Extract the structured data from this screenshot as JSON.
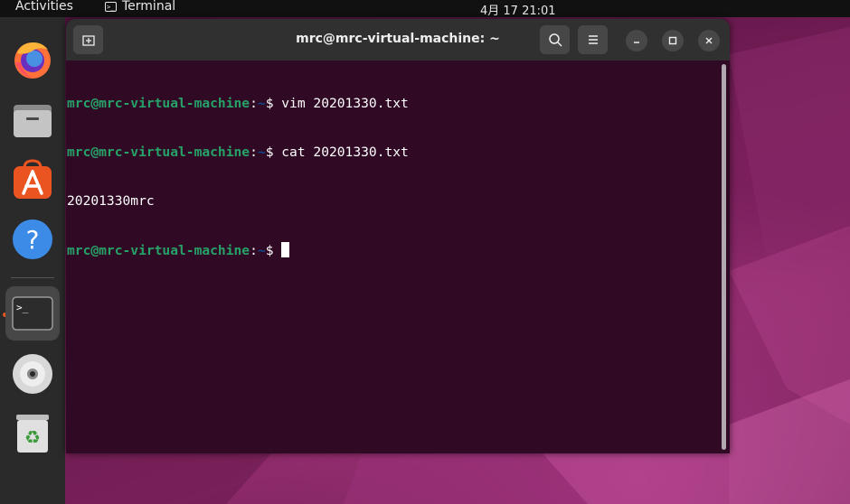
{
  "topbar": {
    "activities_label": "Activities",
    "app_name": "Terminal",
    "clock": "4月 17  21:01"
  },
  "dock": {
    "items": [
      {
        "name": "firefox-icon"
      },
      {
        "name": "files-icon"
      },
      {
        "name": "app-center-icon"
      },
      {
        "name": "help-icon"
      },
      {
        "name": "terminal-icon",
        "active": true
      },
      {
        "name": "dvd-icon"
      },
      {
        "name": "trash-icon"
      }
    ]
  },
  "window": {
    "title": "mrc@mrc-virtual-machine: ~",
    "new_tab_icon": "new-tab-icon",
    "search_icon": "search-icon",
    "menu_icon": "hamburger-menu-icon"
  },
  "terminal": {
    "lines": [
      {
        "user": "mrc@mrc-virtual-machine",
        "path": "~",
        "cmd": "$ vim 20201330.txt"
      },
      {
        "user": "mrc@mrc-virtual-machine",
        "path": "~",
        "cmd": "$ cat 20201330.txt"
      },
      {
        "output": "20201330mrc"
      },
      {
        "user": "mrc@mrc-virtual-machine",
        "path": "~",
        "cmd": "$ "
      }
    ]
  },
  "colors": {
    "terminal_bg": "#300a24",
    "prompt_user": "#26a269",
    "prompt_path": "#12488b",
    "accent": "#e95420",
    "titlebar": "#303030",
    "dock": "#2a2a2a"
  }
}
